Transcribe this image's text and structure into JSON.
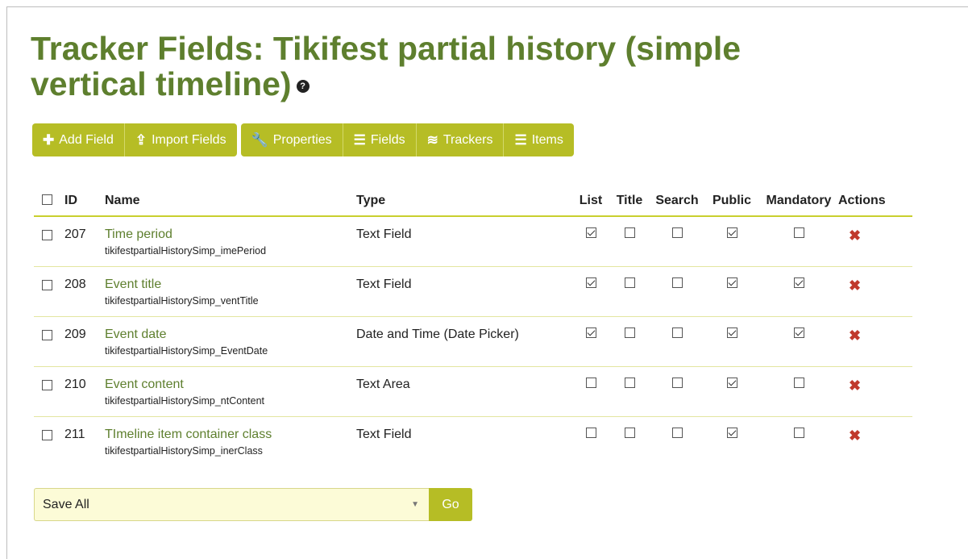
{
  "page": {
    "title": "Tracker Fields: Tikifest partial history (simple vertical timeline)",
    "help_icon": "?"
  },
  "toolbar": {
    "add_field": "Add Field",
    "import_fields": "Import Fields",
    "properties": "Properties",
    "fields": "Fields",
    "trackers": "Trackers",
    "items": "Items"
  },
  "table": {
    "headers": {
      "id": "ID",
      "name": "Name",
      "type": "Type",
      "list": "List",
      "title": "Title",
      "search": "Search",
      "public": "Public",
      "mandatory": "Mandatory",
      "actions": "Actions"
    },
    "rows": [
      {
        "id": "207",
        "name": "Time period",
        "perm": "tikifestpartialHistorySimp_imePeriod",
        "type": "Text Field",
        "list": true,
        "title": false,
        "search": false,
        "public": true,
        "mandatory": false
      },
      {
        "id": "208",
        "name": "Event title",
        "perm": "tikifestpartialHistorySimp_ventTitle",
        "type": "Text Field",
        "list": true,
        "title": false,
        "search": false,
        "public": true,
        "mandatory": true
      },
      {
        "id": "209",
        "name": "Event date",
        "perm": "tikifestpartialHistorySimp_EventDate",
        "type": "Date and Time (Date Picker)",
        "list": true,
        "title": false,
        "search": false,
        "public": true,
        "mandatory": true
      },
      {
        "id": "210",
        "name": "Event content",
        "perm": "tikifestpartialHistorySimp_ntContent",
        "type": "Text Area",
        "list": false,
        "title": false,
        "search": false,
        "public": true,
        "mandatory": false
      },
      {
        "id": "211",
        "name": "TImeline item container class",
        "perm": "tikifestpartialHistorySimp_inerClass",
        "type": "Text Field",
        "list": false,
        "title": false,
        "search": false,
        "public": true,
        "mandatory": false
      }
    ]
  },
  "bulk": {
    "selected": "Save All",
    "go_label": "Go"
  },
  "colors": {
    "accent": "#b6bd25",
    "title": "#5e7f2e",
    "delete": "#c0392b"
  }
}
